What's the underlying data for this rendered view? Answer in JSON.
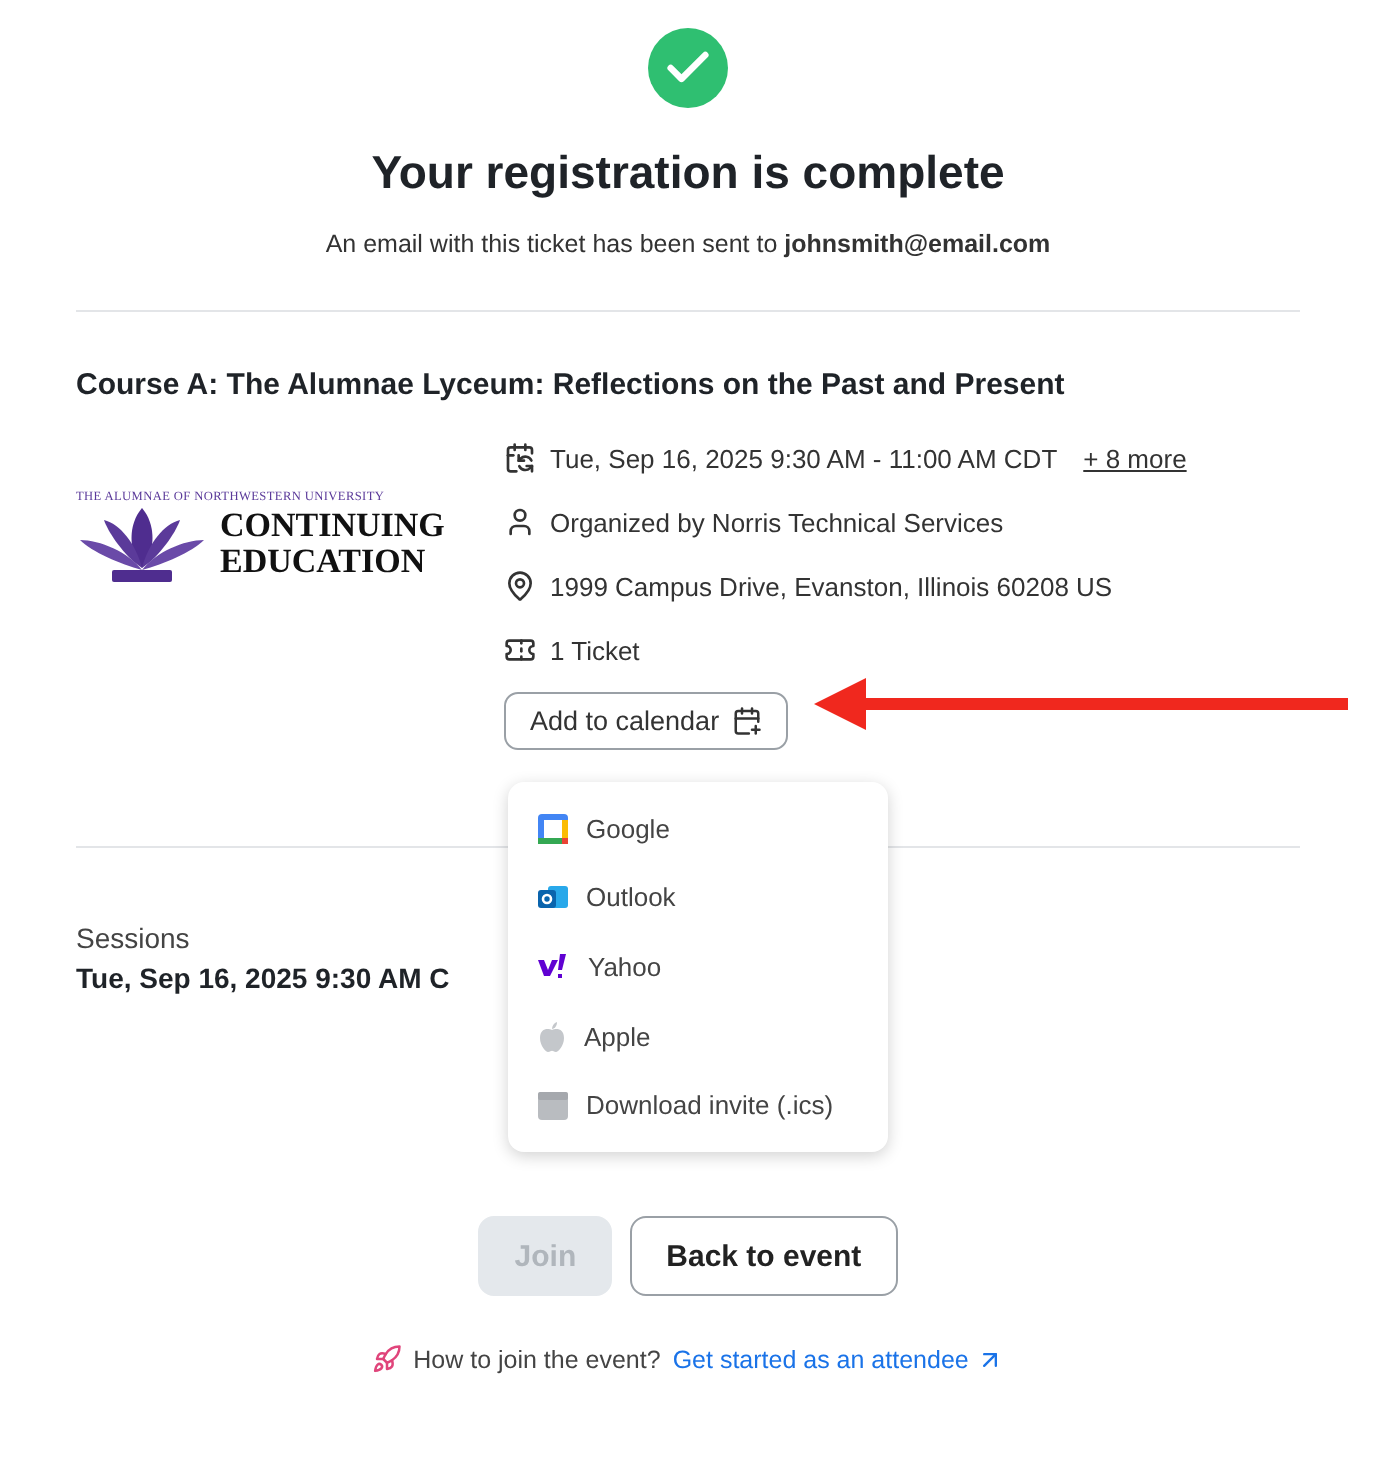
{
  "header": {
    "title": "Your registration is complete",
    "message": "An email with this ticket has been sent to **johnsmith@email.com**"
  },
  "event": {
    "title": "Course A: The Alumnae Lyceum: Reflections on the Past and Present",
    "logo": {
      "tagline": "THE ALUMNAE OF NORTHWESTERN UNIVERSITY",
      "line_1": "CONTINUING",
      "line_2": "EDUCATION"
    },
    "details": [
      {
        "kind": "date",
        "text": "Tue, Sep 16, 2025 9:30 AM - 11:00 AM CDT",
        "link": "+ 8 more"
      },
      {
        "kind": "organizer",
        "text": "Organized by Norris Technical Services"
      },
      {
        "kind": "location",
        "text": "1999 Campus Drive, Evanston, Illinois 60208 US"
      },
      {
        "kind": "ticket",
        "text": "1 Ticket"
      }
    ],
    "calendar_button": {
      "label": "Add to calendar"
    },
    "calendar_menu": [
      {
        "kind": "google",
        "label": "Google"
      },
      {
        "kind": "outlook",
        "label": "Outlook"
      },
      {
        "kind": "yahoo",
        "label": "Yahoo"
      },
      {
        "kind": "apple",
        "label": "Apple"
      },
      {
        "kind": "ics",
        "label": "Download invite (.ics)"
      }
    ]
  },
  "sessions": {
    "label": "Sessions",
    "first": "Tue, Sep 16, 2025 9:30 AM C"
  },
  "buttons": [
    {
      "label": "Join",
      "disabled": true
    },
    {
      "label": "Back to event",
      "disabled": false
    }
  ],
  "footer": {
    "question": "How to join the event?",
    "link": "Get started as an attendee"
  }
}
